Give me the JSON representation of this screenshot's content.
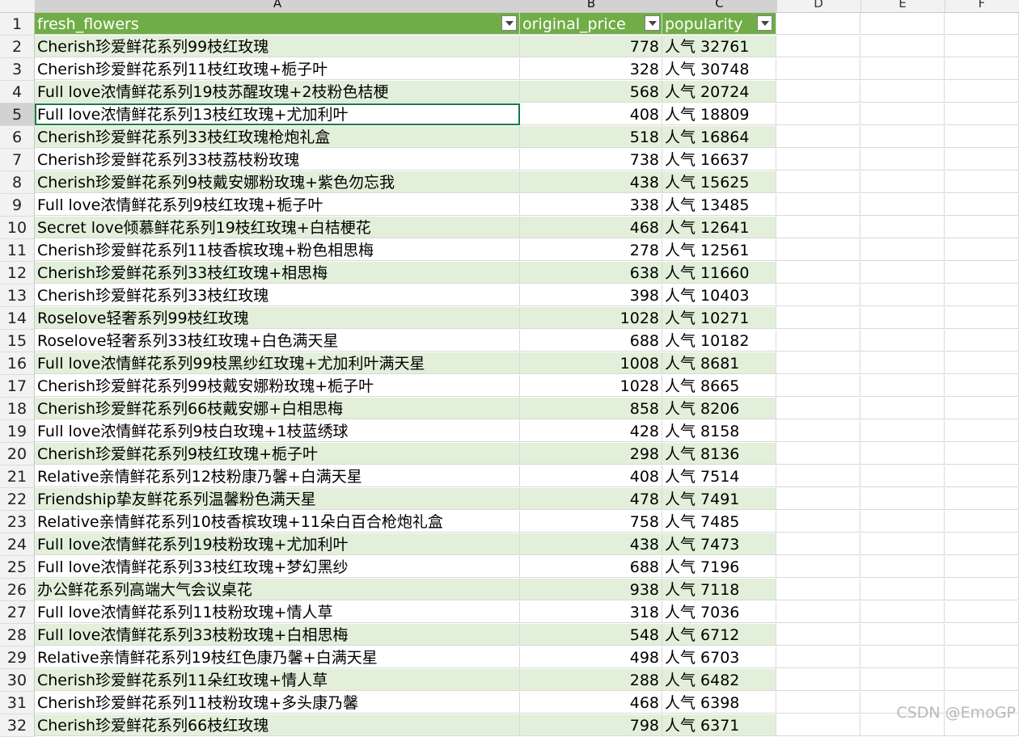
{
  "columns": [
    "A",
    "B",
    "C",
    "D",
    "E",
    "F"
  ],
  "header": {
    "row_number": "1",
    "col_a": "fresh_flowers",
    "col_b": "original_price",
    "col_c": "popularity"
  },
  "rows": [
    {
      "n": "2",
      "name": "Cherish珍爱鲜花系列99枝红玫瑰",
      "price": "778",
      "pop": "人气 32761"
    },
    {
      "n": "3",
      "name": "Cherish珍爱鲜花系列11枝红玫瑰+栀子叶",
      "price": "328",
      "pop": "人气 30748"
    },
    {
      "n": "4",
      "name": "Full love浓情鲜花系列19枝苏醒玫瑰+2枝粉色桔梗",
      "price": "568",
      "pop": "人气 20724"
    },
    {
      "n": "5",
      "name": "Full love浓情鲜花系列13枝红玫瑰+尤加利叶",
      "price": "408",
      "pop": "人气 18809"
    },
    {
      "n": "6",
      "name": "Cherish珍爱鲜花系列33枝红玫瑰枪炮礼盒",
      "price": "518",
      "pop": "人气 16864"
    },
    {
      "n": "7",
      "name": "Cherish珍爱鲜花系列33枝荔枝粉玫瑰",
      "price": "738",
      "pop": "人气 16637"
    },
    {
      "n": "8",
      "name": "Cherish珍爱鲜花系列9枝戴安娜粉玫瑰+紫色勿忘我",
      "price": "438",
      "pop": "人气 15625"
    },
    {
      "n": "9",
      "name": "Full love浓情鲜花系列9枝红玫瑰+栀子叶",
      "price": "338",
      "pop": "人气 13485"
    },
    {
      "n": "10",
      "name": "Secret love倾慕鲜花系列19枝红玫瑰+白桔梗花",
      "price": "468",
      "pop": "人气 12641"
    },
    {
      "n": "11",
      "name": "Cherish珍爱鲜花系列11枝香槟玫瑰+粉色相思梅",
      "price": "278",
      "pop": "人气 12561"
    },
    {
      "n": "12",
      "name": "Cherish珍爱鲜花系列33枝红玫瑰+相思梅",
      "price": "638",
      "pop": "人气 11660"
    },
    {
      "n": "13",
      "name": "Cherish珍爱鲜花系列33枝红玫瑰",
      "price": "398",
      "pop": "人气 10403"
    },
    {
      "n": "14",
      "name": "Roselove轻奢系列99枝红玫瑰",
      "price": "1028",
      "pop": "人气 10271"
    },
    {
      "n": "15",
      "name": "Roselove轻奢系列33枝红玫瑰+白色满天星",
      "price": "688",
      "pop": "人气 10182"
    },
    {
      "n": "16",
      "name": "Full love浓情鲜花系列99枝黑纱红玫瑰+尤加利叶满天星",
      "price": "1008",
      "pop": "人气 8681"
    },
    {
      "n": "17",
      "name": "Cherish珍爱鲜花系列99枝戴安娜粉玫瑰+栀子叶",
      "price": "1028",
      "pop": "人气 8665"
    },
    {
      "n": "18",
      "name": "Cherish珍爱鲜花系列66枝戴安娜+白相思梅",
      "price": "858",
      "pop": "人气 8206"
    },
    {
      "n": "19",
      "name": "Full love浓情鲜花系列9枝白玫瑰+1枝蓝绣球",
      "price": "428",
      "pop": "人气 8158"
    },
    {
      "n": "20",
      "name": "Cherish珍爱鲜花系列9枝红玫瑰+栀子叶",
      "price": "298",
      "pop": "人气 8136"
    },
    {
      "n": "21",
      "name": "Relative亲情鲜花系列12枝粉康乃馨+白满天星",
      "price": "408",
      "pop": "人气 7514"
    },
    {
      "n": "22",
      "name": "Friendship挚友鲜花系列温馨粉色满天星",
      "price": "478",
      "pop": "人气 7491"
    },
    {
      "n": "23",
      "name": "Relative亲情鲜花系列10枝香槟玫瑰+11朵白百合枪炮礼盒",
      "price": "758",
      "pop": "人气 7485"
    },
    {
      "n": "24",
      "name": "Full love浓情鲜花系列19枝粉玫瑰+尤加利叶",
      "price": "438",
      "pop": "人气 7473"
    },
    {
      "n": "25",
      "name": "Full love浓情鲜花系列33枝红玫瑰+梦幻黑纱",
      "price": "688",
      "pop": "人气 7196"
    },
    {
      "n": "26",
      "name": "办公鲜花系列高端大气会议桌花",
      "price": "938",
      "pop": "人气 7118"
    },
    {
      "n": "27",
      "name": "Full love浓情鲜花系列11枝粉玫瑰+情人草",
      "price": "318",
      "pop": "人气 7036"
    },
    {
      "n": "28",
      "name": "Full love浓情鲜花系列33枝粉玫瑰+白相思梅",
      "price": "548",
      "pop": "人气 6712"
    },
    {
      "n": "29",
      "name": "Relative亲情鲜花系列19枝红色康乃馨+白满天星",
      "price": "498",
      "pop": "人气 6703"
    },
    {
      "n": "30",
      "name": "Cherish珍爱鲜花系列11朵红玫瑰+情人草",
      "price": "288",
      "pop": "人气 6482"
    },
    {
      "n": "31",
      "name": "Cherish珍爱鲜花系列11枝粉玫瑰+多头康乃馨",
      "price": "468",
      "pop": "人气 6398"
    },
    {
      "n": "32",
      "name": "Cherish珍爱鲜花系列66枝红玫瑰",
      "price": "798",
      "pop": "人气 6371"
    }
  ],
  "watermark": "CSDN @EmoGP",
  "colors": {
    "header_green": "#70ad47",
    "band_green": "#e2efda",
    "grid": "#d9d9d9"
  }
}
